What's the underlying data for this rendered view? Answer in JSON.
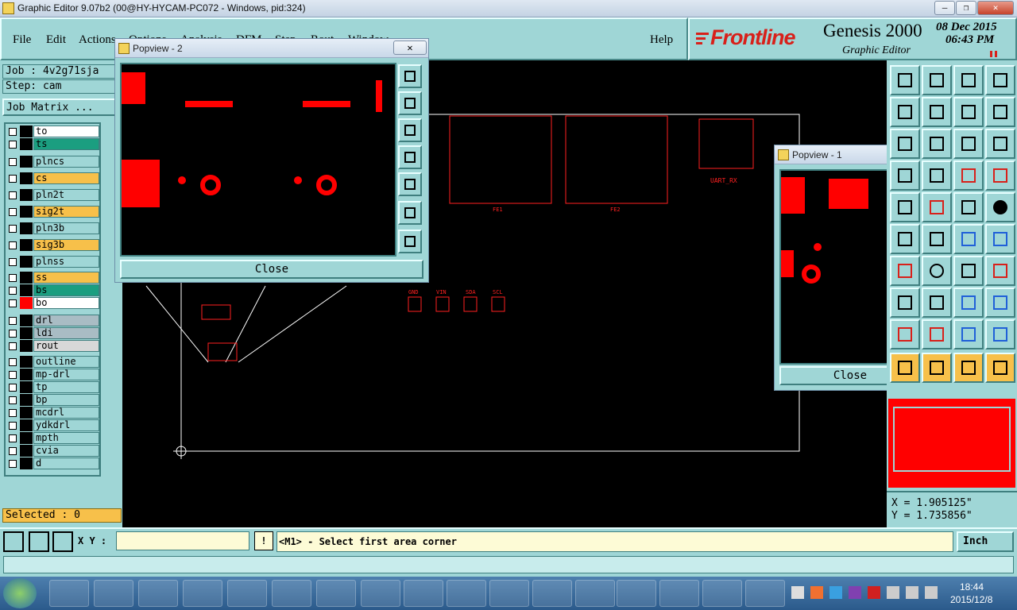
{
  "window": {
    "title": "Graphic Editor 9.07b2 (00@HY-HYCAM-PC072 - Windows, pid:324)",
    "minimize": "—",
    "restore": "❐",
    "close": "✕"
  },
  "menu": {
    "items": [
      "File",
      "Edit",
      "Actions",
      "Options",
      "Analysis",
      "DFM",
      "Step",
      "Rout",
      "Window"
    ],
    "help": "Help"
  },
  "brand": {
    "logo": "Frontline",
    "product": "Genesis 2000",
    "subtitle": "Graphic Editor",
    "date": "08 Dec 2015",
    "time": "06:43 PM"
  },
  "job": {
    "job_label": "Job : 4v2g71sja",
    "step_label": "Step: cam",
    "matrix_button": "Job Matrix ..."
  },
  "layers": {
    "group1": [
      {
        "name": "to",
        "color": "#ffffff"
      },
      {
        "name": "ts",
        "color": "#1b9e80"
      }
    ],
    "group2": [
      {
        "name": "plncs",
        "color": "#9fd6d6"
      },
      {
        "name": "cs",
        "color": "#f7c04a"
      },
      {
        "name": "pln2t",
        "color": "#9fd6d6"
      },
      {
        "name": "sig2t",
        "color": "#f7c04a"
      },
      {
        "name": "pln3b",
        "color": "#9fd6d6"
      },
      {
        "name": "sig3b",
        "color": "#f7c04a"
      },
      {
        "name": "plnss",
        "color": "#9fd6d6"
      }
    ],
    "group3": [
      {
        "name": "ss",
        "color": "#f7c04a"
      },
      {
        "name": "bs",
        "color": "#1b9e80"
      },
      {
        "name": "bo",
        "color": "#ffffff"
      }
    ],
    "group4": [
      {
        "name": "drl",
        "color": "#a9bcc4"
      },
      {
        "name": "ldi",
        "color": "#a9bcc4"
      },
      {
        "name": "rout",
        "color": "#d8d8d8"
      }
    ],
    "group5": [
      {
        "name": "outline",
        "color": "#9fd6d6"
      },
      {
        "name": "mp-drl",
        "color": "#9fd6d6"
      },
      {
        "name": "tp",
        "color": "#9fd6d6"
      },
      {
        "name": "bp",
        "color": "#9fd6d6"
      },
      {
        "name": "mcdrl",
        "color": "#9fd6d6"
      },
      {
        "name": "ydkdrl",
        "color": "#9fd6d6"
      },
      {
        "name": "mpth",
        "color": "#9fd6d6"
      },
      {
        "name": "cvia",
        "color": "#9fd6d6"
      },
      {
        "name": "d",
        "color": "#9fd6d6"
      }
    ],
    "selected": "Selected : 0"
  },
  "popview2": {
    "title": "Popview - 2",
    "close": "Close",
    "x": "✕"
  },
  "popview1": {
    "title": "Popview - 1",
    "close": "Close",
    "x": "✕"
  },
  "canvas_labels": {
    "fe1": "FE1",
    "fe2": "FE2",
    "uart": "UART_RX",
    "gnd": "GND",
    "vin": "VIN",
    "sda": "SDA",
    "scl": "SCL"
  },
  "coordinates": {
    "x": "X = 1.905125\"",
    "y": "Y = 1.735856\""
  },
  "status": {
    "xy_label": "X Y :",
    "xy_value": "",
    "message": "<M1> - Select first area corner",
    "units": "Inch"
  },
  "taskbar": {
    "time": "18:44",
    "date": "2015/12/8"
  },
  "colors": {
    "panel": "#9fd6d6",
    "layer_red": "#ff0000",
    "accent_orange": "#f7c04a",
    "teal": "#1b9e80"
  }
}
